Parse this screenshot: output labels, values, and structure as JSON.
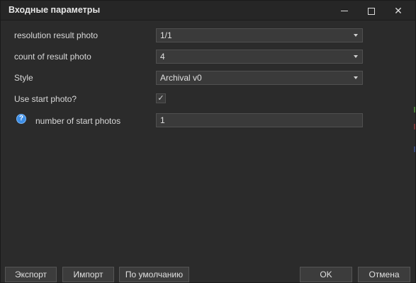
{
  "window": {
    "title": "Входные параметры",
    "controls": {
      "minimize_icon": "minimize-icon",
      "maximize_icon": "maximize-icon",
      "close_glyph": "✕"
    }
  },
  "form": {
    "resolution": {
      "label": "resolution result photo",
      "value": "1/1"
    },
    "count": {
      "label": "count of result photo",
      "value": "4"
    },
    "style": {
      "label": "Style",
      "value": "Archival v0"
    },
    "use_start_photo": {
      "label": "Use start photo?",
      "checked": true,
      "check_glyph": "✓"
    },
    "start_photos": {
      "help_glyph": "?",
      "label": "number of start photos",
      "value": "1"
    }
  },
  "buttons": {
    "export": "Экспорт",
    "import": "Импорт",
    "defaults": "По умолчанию",
    "ok": "OK",
    "cancel": "Отмена"
  },
  "colors": {
    "background": "#2b2b2b",
    "titlebar": "#262626",
    "field": "#3a3a3a",
    "accent": "#3d8ee6"
  }
}
